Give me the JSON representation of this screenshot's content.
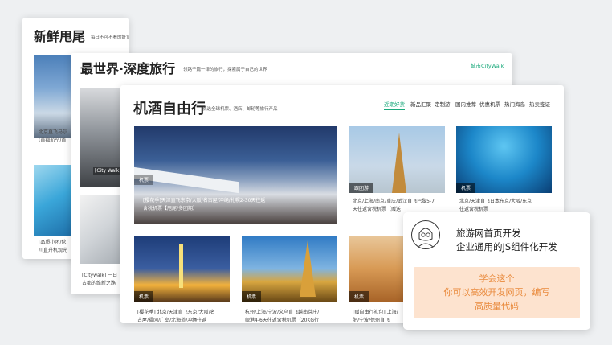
{
  "card1": {
    "title": "新鲜甩尾",
    "subtitle": "每日不可不看的好货",
    "caption1_l1": "北京直飞马尔",
    "caption1_l2": "(首都航空/首",
    "caption2_l1": "[品质小团/伙",
    "caption2_l2": "川直升机观光"
  },
  "card2": {
    "title": "最世界·深度旅行",
    "subtitle": "领路千篇一律的旅行，探索属于自己的世界",
    "link": "城市CityWalk",
    "photo_tag": "[City Walk]",
    "caption_l1": "[Citywalk] 一日",
    "caption_l2": "古都的维新之路"
  },
  "card3": {
    "title": "机酒自由行",
    "subtitle": "挑选全球机票、酒店、邮轮等旅行产品",
    "tabs": [
      "近期好货",
      "新品汇聚",
      "定制游",
      "国内推荐",
      "优惠机票",
      "热门海岛",
      "热卖签证"
    ],
    "big": {
      "tag": "机票",
      "caption_l1": "[樱花季]天津直飞东京/大阪/名古屋/冲绳/札幌2-30天往返",
      "caption_l2": "含税机票【甩尾/多团期】"
    },
    "tiles": [
      {
        "tag": "跟团游",
        "l1": "北京/上海/南京/重庆/武汉直飞巴黎5-7",
        "l2": "天往返含税机票（赠送"
      },
      {
        "tag": "机票",
        "l1": "北京/天津直飞日本东京/大阪/东京",
        "l2": "往返含税机票"
      },
      {
        "tag": "机票",
        "l1": "[樱花季] 北京/天津直飞东京/大阪/名",
        "l2": "古屋/福冈/广岛/北海道/冲绳往返"
      },
      {
        "tag": "机票",
        "l1": "杭州/上海/宁波/义乌直飞越南芽庄/",
        "l2": "岘港4-6天往返含税机票（20KG行"
      },
      {
        "tag": "机票",
        "l1": "[赠自由行礼包] 上海/",
        "l2": "肥/宁波/徐州直飞"
      }
    ]
  },
  "promo": {
    "line1": "旅游网首页开发",
    "line2": "企业通用的JS组件化开发",
    "box_l1": "学会这个",
    "box_l2": "你可以高效开发网页，编写",
    "box_l3": "高质量代码"
  },
  "colors": {
    "accent": "#1aa97b",
    "promo_box": "#fde3cf",
    "promo_text": "#e98a3c"
  }
}
